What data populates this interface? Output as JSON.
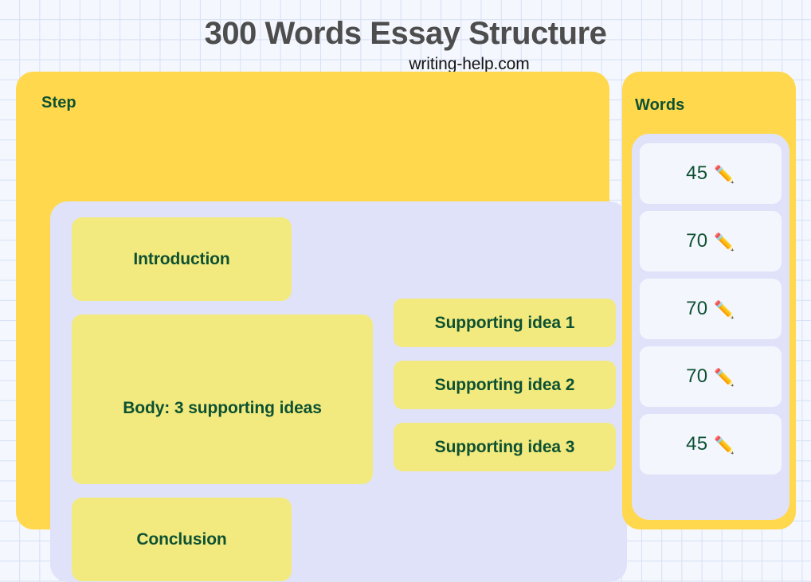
{
  "header": {
    "title": "300 Words Essay Structure",
    "subtitle": "writing-help.com"
  },
  "colors": {
    "page_background": "#F4F7FD",
    "grid_line": "#D6E0F5",
    "header_yellow": "#FFD84D",
    "box_yellow": "#F2EA7E",
    "panel_lavender": "#E0E2FA",
    "card_white": "#F4F6FE",
    "text_green": "#0E5132",
    "title_gray": "#4D4D4D"
  },
  "step_column": {
    "header_label": "Step",
    "main_steps": [
      {
        "label": "Introduction"
      },
      {
        "label": "Body: 3 supporting ideas"
      },
      {
        "label": "Conclusion"
      }
    ],
    "supporting_ideas": [
      {
        "label": "Supporting idea 1"
      },
      {
        "label": "Supporting idea 2"
      },
      {
        "label": "Supporting idea 3"
      }
    ]
  },
  "words_column": {
    "header_label": "Words",
    "icon": "pencil-icon",
    "icon_glyph": "✏️",
    "cards": [
      {
        "count": "45"
      },
      {
        "count": "70"
      },
      {
        "count": "70"
      },
      {
        "count": "70"
      },
      {
        "count": "45"
      }
    ]
  }
}
